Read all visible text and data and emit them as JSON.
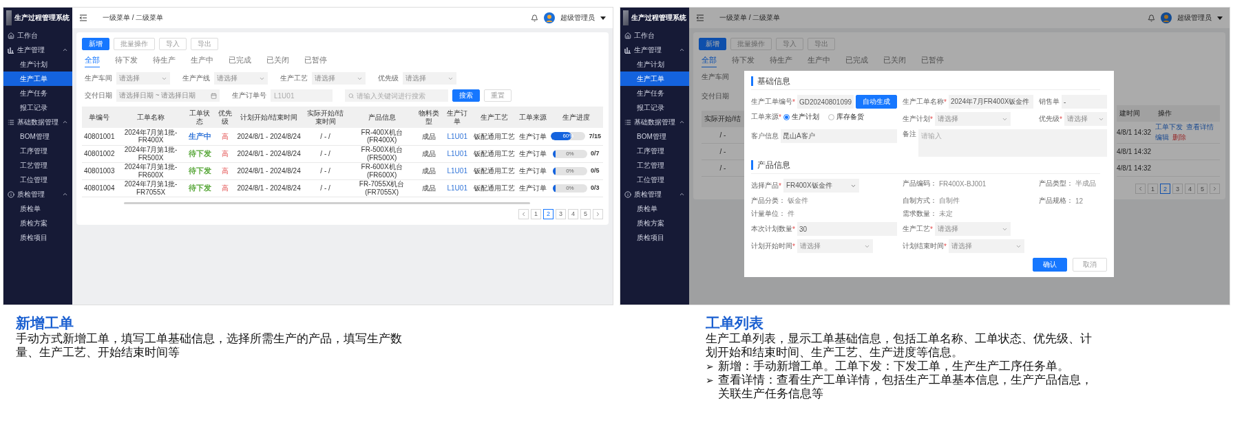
{
  "screens": [
    {
      "sidebar": {
        "title": "生产过程管理系统",
        "items": [
          {
            "label": "工作台",
            "selected": false
          },
          {
            "label": "生产管理",
            "selected": false,
            "expanded": true,
            "children": [
              {
                "label": "生产计划",
                "selected": false
              },
              {
                "label": "生产工单",
                "selected": true
              },
              {
                "label": "生产任务",
                "selected": false
              },
              {
                "label": "报工记录",
                "selected": false
              }
            ]
          },
          {
            "label": "基础数据管理",
            "selected": false,
            "expanded": true,
            "children": [
              {
                "label": "BOM管理",
                "selected": false
              },
              {
                "label": "工序管理",
                "selected": false
              },
              {
                "label": "工艺管理",
                "selected": false
              },
              {
                "label": "工位管理",
                "selected": false
              }
            ]
          },
          {
            "label": "质检管理",
            "selected": false,
            "expanded": true,
            "children": [
              {
                "label": "质检单",
                "selected": false
              },
              {
                "label": "质检方案",
                "selected": false
              },
              {
                "label": "质检项目",
                "selected": false
              }
            ]
          }
        ]
      },
      "header": {
        "breadcrumb": "一级菜单 / 二级菜单",
        "user": "超级管理员"
      },
      "toolbar": [
        {
          "label": "新增",
          "kind": "primary"
        },
        {
          "label": "批量操作",
          "kind": "default"
        },
        {
          "label": "导入",
          "kind": "default"
        },
        {
          "label": "导出",
          "kind": "default"
        }
      ],
      "tabs": [
        {
          "label": "全部",
          "selected": true
        },
        {
          "label": "待下发",
          "selected": false
        },
        {
          "label": "待生产",
          "selected": false
        },
        {
          "label": "生产中",
          "selected": false
        },
        {
          "label": "已完成",
          "selected": false
        },
        {
          "label": "已关闭",
          "selected": false
        },
        {
          "label": "已暂停",
          "selected": false
        }
      ],
      "filters": [
        {
          "label": "生产车间",
          "placeholder": "请选择"
        },
        {
          "label": "生产产线",
          "placeholder": "请选择"
        },
        {
          "label": "生产工艺",
          "placeholder": "请选择"
        },
        {
          "label": "优先级",
          "placeholder": "请选择"
        }
      ],
      "date_filter": {
        "label": "交付日期",
        "start_placeholder": "请选择日期",
        "separator": "~",
        "end_placeholder": "请选择日期"
      },
      "order_filter": {
        "label": "生产订单号",
        "placeholder": "L1U01"
      },
      "search": {
        "placeholder": "请输入关键词进行搜索",
        "buttons": [
          {
            "label": "搜索",
            "kind": "primary"
          },
          {
            "label": "重置",
            "kind": "default"
          }
        ]
      },
      "table": {
        "columns": [
          "单编号",
          "工单名称",
          "工单状态",
          "优先级",
          "计划开始/结束时间",
          "实际开始/结束时间",
          "产品信息",
          "物料类型",
          "生产订单",
          "生产工艺",
          "工单来源",
          "生产进度"
        ],
        "rows": [
          {
            "code": "40801001",
            "name": "2024年7月第1批-FR400X",
            "status": {
              "text": "生产中",
              "color": "#2f73d8"
            },
            "priority": "高",
            "plan": "2024/8/1 - 2024/8/24",
            "actual": "/ - /",
            "product": "FR-400X机台(FR400X)",
            "material": "成品",
            "order": "L1U01",
            "process": "钣配通用工艺",
            "source": "生产订单",
            "progress": {
              "level": 0.6,
              "label": "60%",
              "count": "7/15"
            }
          },
          {
            "code": "40801002",
            "name": "2024年7月第1批-FR500X",
            "status": {
              "text": "待下发",
              "color": "#5aa83c"
            },
            "priority": "高",
            "plan": "2024/8/1 - 2024/8/24",
            "actual": "/ - /",
            "product": "FR-500X机台(FR500X)",
            "material": "成品",
            "order": "L1U01",
            "process": "钣配通用工艺",
            "source": "生产订单",
            "progress": {
              "level": 0,
              "label": "0%",
              "count": "0/7"
            }
          },
          {
            "code": "40801003",
            "name": "2024年7月第1批-FR600X",
            "status": {
              "text": "待下发",
              "color": "#5aa83c"
            },
            "priority": "高",
            "plan": "2024/8/1 - 2024/8/24",
            "actual": "/ - /",
            "product": "FR-600X机台(FR600X)",
            "material": "成品",
            "order": "L1U01",
            "process": "钣配通用工艺",
            "source": "生产订单",
            "progress": {
              "level": 0,
              "label": "0%",
              "count": "0/5"
            }
          },
          {
            "code": "40801004",
            "name": "2024年7月第1批-FR7055X",
            "status": {
              "text": "待下发",
              "color": "#5aa83c"
            },
            "priority": "高",
            "plan": "2024/8/1 - 2024/8/24",
            "actual": "/ - /",
            "product": "FR-7055X机台(FR7055X)",
            "material": "成品",
            "order": "L1U01",
            "process": "钣配通用工艺",
            "source": "生产订单",
            "progress": {
              "level": 0,
              "label": "0%",
              "count": "0/3"
            }
          }
        ]
      },
      "pagination": [
        {
          "label": "1",
          "selected": false
        },
        {
          "label": "2",
          "selected": true
        },
        {
          "label": "3",
          "selected": false
        },
        {
          "label": "4",
          "selected": false
        },
        {
          "label": "5",
          "selected": false
        }
      ]
    },
    {
      "sidebar": {
        "title": "生产过程管理系统",
        "items": [
          {
            "label": "工作台",
            "selected": false
          },
          {
            "label": "生产管理",
            "selected": false,
            "expanded": true,
            "children": [
              {
                "label": "生产计划",
                "selected": false
              },
              {
                "label": "生产工单",
                "selected": true
              },
              {
                "label": "生产任务",
                "selected": false
              },
              {
                "label": "报工记录",
                "selected": false
              }
            ]
          },
          {
            "label": "基础数据管理",
            "selected": false,
            "expanded": true,
            "children": [
              {
                "label": "BOM管理",
                "selected": false
              },
              {
                "label": "工序管理",
                "selected": false
              },
              {
                "label": "工艺管理",
                "selected": false
              },
              {
                "label": "工位管理",
                "selected": false
              }
            ]
          },
          {
            "label": "质检管理",
            "selected": false,
            "expanded": true,
            "children": [
              {
                "label": "质检单",
                "selected": false
              },
              {
                "label": "质检方案",
                "selected": false
              },
              {
                "label": "质检项目",
                "selected": false
              }
            ]
          }
        ]
      },
      "header": {
        "breadcrumb": "一级菜单 / 二级菜单",
        "user": "超级管理员"
      },
      "toolbar": [
        {
          "label": "新增",
          "kind": "primary"
        },
        {
          "label": "批量操作",
          "kind": "default"
        },
        {
          "label": "导入",
          "kind": "default"
        },
        {
          "label": "导出",
          "kind": "default"
        }
      ],
      "tabs": [
        {
          "label": "全部",
          "selected": true
        },
        {
          "label": "待下发",
          "selected": false
        },
        {
          "label": "待生产",
          "selected": false
        },
        {
          "label": "生产中",
          "selected": false
        },
        {
          "label": "已完成",
          "selected": false
        },
        {
          "label": "已关闭",
          "selected": false
        },
        {
          "label": "已暂停",
          "selected": false
        }
      ],
      "backdrop": {
        "left_labels": [
          "生产车间",
          "交付日期"
        ],
        "left_column": "实际开始/结",
        "left_cells": [
          "/ -",
          "/ -",
          "/ -"
        ],
        "right_columns": [
          "建时间",
          "操作"
        ],
        "right_rows": [
          {
            "created": "4/8/1 14:32",
            "actions": [
              {
                "label": "工单下发",
                "kind": "link"
              },
              {
                "label": "查看详情",
                "kind": "link"
              },
              {
                "label": "编辑",
                "kind": "link"
              },
              {
                "label": "删除",
                "kind": "danger"
              }
            ]
          },
          {
            "created": "4/8/1 14:32"
          },
          {
            "created": "4/8/1 14:32"
          }
        ],
        "pagination": [
          {
            "label": "1",
            "selected": false
          },
          {
            "label": "2",
            "selected": true
          },
          {
            "label": "3",
            "selected": false
          },
          {
            "label": "4",
            "selected": false
          },
          {
            "label": "5",
            "selected": false
          }
        ]
      },
      "dialog": {
        "sections": [
          {
            "title": "基础信息",
            "rows": [
              [
                {
                  "label": "生产工单编号",
                  "required_mark": "*",
                  "kind": "input",
                  "value": "GD20240801099",
                  "action": "自动生成"
                },
                {
                  "label": "生产工单名称",
                  "required_mark": "*",
                  "kind": "input",
                  "value": "2024年7月FR400X钣金件"
                },
                {
                  "label": "销售单",
                  "kind": "input",
                  "value": "-"
                }
              ],
              [
                {
                  "label": "工单来源",
                  "required_mark": "*",
                  "kind": "radio",
                  "options": [
                    {
                      "label": "生产计划",
                      "selected": true
                    },
                    {
                      "label": "库存备货",
                      "selected": false
                    }
                  ]
                },
                {
                  "label": "生产计划",
                  "required_mark": "*",
                  "kind": "select",
                  "placeholder": "请选择"
                },
                {
                  "label": "优先级",
                  "required_mark": "*",
                  "kind": "select",
                  "placeholder": "请选择"
                }
              ],
              [
                {
                  "label": "客户信息",
                  "kind": "input",
                  "value": "昆山A客户"
                },
                {
                  "label": "备注",
                  "kind": "textarea",
                  "placeholder": "请输入"
                }
              ]
            ]
          },
          {
            "title": "产品信息",
            "rows": [
              [
                {
                  "label": "选择产品",
                  "required_mark": "*",
                  "kind": "select",
                  "value": "FR400X钣金件"
                },
                {
                  "label": "产品编码：",
                  "kind": "info",
                  "value": "FR400X-BJ001"
                },
                {
                  "label": "产品类型：",
                  "kind": "info",
                  "value": "半成品"
                }
              ],
              [
                {
                  "label": "产品分类：",
                  "kind": "info",
                  "value": "钣金件"
                },
                {
                  "label": "自制方式：",
                  "kind": "info",
                  "value": "自制件"
                },
                {
                  "label": "产品规格：",
                  "kind": "info",
                  "value": "12"
                }
              ],
              [
                {
                  "label": "计量单位：",
                  "kind": "info",
                  "value": "件"
                },
                {
                  "label": "需求数量：",
                  "kind": "info",
                  "value": "未定"
                }
              ],
              [
                {
                  "label": "本次计划数量",
                  "required_mark": "*",
                  "kind": "input",
                  "value": "30"
                },
                {
                  "label": "生产工艺",
                  "required_mark": "*",
                  "kind": "select",
                  "placeholder": "请选择"
                }
              ],
              [
                {
                  "label": "计划开始时间",
                  "required_mark": "*",
                  "kind": "select",
                  "placeholder": "请选择"
                },
                {
                  "label": "计划结束时间",
                  "required_mark": "*",
                  "kind": "select",
                  "placeholder": "请选择"
                }
              ]
            ]
          }
        ],
        "buttons": [
          {
            "label": "确认",
            "kind": "primary"
          },
          {
            "label": "取消",
            "kind": "default"
          }
        ]
      }
    }
  ],
  "captions": [
    {
      "title": "新增工单",
      "paragraphs": [
        {
          "text": "手动方式新增工单，填写工单基础信息，选择所需生产的产品，填写生产数量、生产工艺、开始结束时间等"
        }
      ]
    },
    {
      "title": "工单列表",
      "paragraphs": [
        {
          "text": "生产工单列表，显示工单基础信息，包括工单名称、工单状态、优先级、计划开始和结束时间、生产工艺、生产进度等信息。"
        },
        {
          "bullet": "➢",
          "text": "新增：手动新增工单。工单下发：下发工单，生产生产工序任务单。"
        },
        {
          "bullet": "➢",
          "text": "查看详情：查看生产工单详情，包括生产工单基本信息，生产产品信息，关联生产任务信息等"
        }
      ]
    }
  ]
}
